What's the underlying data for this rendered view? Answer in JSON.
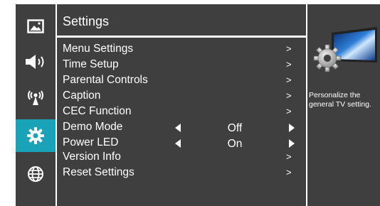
{
  "sidebar": {
    "items": [
      {
        "icon": "picture-icon",
        "active": false
      },
      {
        "icon": "speaker-icon",
        "active": false
      },
      {
        "icon": "antenna-icon",
        "active": false
      },
      {
        "icon": "gear-icon",
        "active": true
      },
      {
        "icon": "globe-icon",
        "active": false
      }
    ],
    "active_color": "#1aa3b8"
  },
  "main": {
    "title": "Settings",
    "items": [
      {
        "label": "Menu Settings",
        "arrow": ">"
      },
      {
        "label": "Time Setup",
        "arrow": ">"
      },
      {
        "label": "Parental Controls",
        "arrow": ">"
      },
      {
        "label": "Caption",
        "arrow": ">"
      },
      {
        "label": "CEC Function",
        "arrow": ">"
      },
      {
        "label": "Demo Mode",
        "value": "Off"
      },
      {
        "label": "Power LED",
        "value": "On"
      },
      {
        "label": "Version Info",
        "arrow": ">"
      },
      {
        "label": "Reset Settings",
        "arrow": ">"
      }
    ]
  },
  "info": {
    "graphic": "tv-gear-icon",
    "description": "Personalize the general TV setting."
  },
  "colors": {
    "panel": "#3f3f3f",
    "accent": "#1aa3b8",
    "text": "#ffffff"
  }
}
